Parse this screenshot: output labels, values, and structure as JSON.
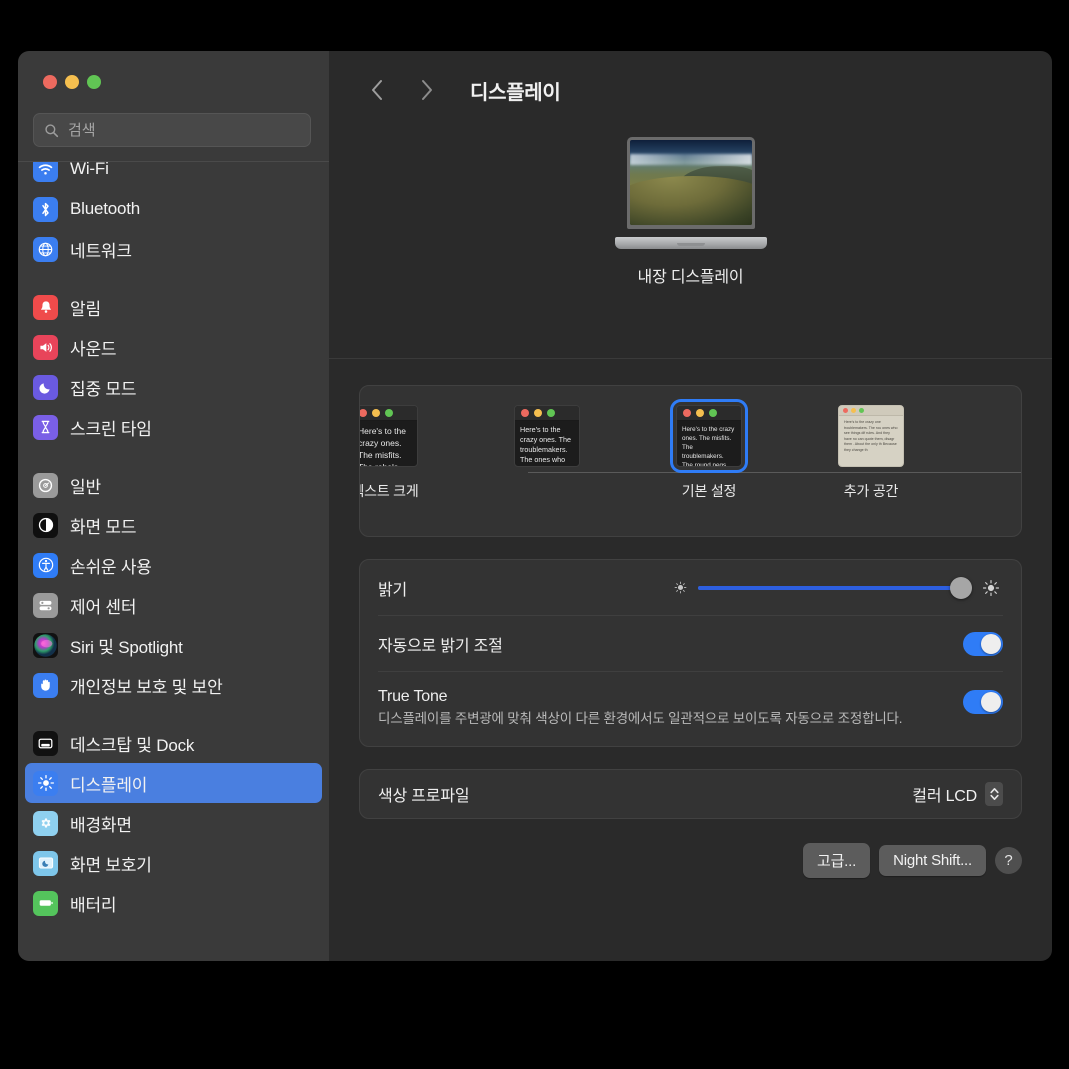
{
  "window": {
    "traffic_lights": [
      {
        "name": "close",
        "color": "#ed6a5f"
      },
      {
        "name": "minimize",
        "color": "#f5bf4f"
      },
      {
        "name": "zoom",
        "color": "#61c554"
      }
    ]
  },
  "search": {
    "placeholder": "검색",
    "value": "",
    "icon": "search-icon"
  },
  "sidebar": {
    "groups": [
      {
        "items": [
          {
            "label": "Wi-Fi",
            "icon": "wifi-icon",
            "selected": false
          },
          {
            "label": "Bluetooth",
            "icon": "bluetooth-icon",
            "selected": false
          },
          {
            "label": "네트워크",
            "icon": "globe-icon",
            "selected": false
          }
        ]
      },
      {
        "items": [
          {
            "label": "알림",
            "icon": "bell-icon",
            "selected": false
          },
          {
            "label": "사운드",
            "icon": "speaker-icon",
            "selected": false
          },
          {
            "label": "집중 모드",
            "icon": "moon-icon",
            "selected": false
          },
          {
            "label": "스크린 타임",
            "icon": "hourglass-icon",
            "selected": false
          }
        ]
      },
      {
        "items": [
          {
            "label": "일반",
            "icon": "gear-icon",
            "selected": false
          },
          {
            "label": "화면 모드",
            "icon": "appearance-icon",
            "selected": false
          },
          {
            "label": "손쉬운 사용",
            "icon": "accessibility-icon",
            "selected": false
          },
          {
            "label": "제어 센터",
            "icon": "control-center-icon",
            "selected": false
          },
          {
            "label": "Siri 및 Spotlight",
            "icon": "siri-icon",
            "selected": false
          },
          {
            "label": "개인정보 보호 및 보안",
            "icon": "hand-privacy-icon",
            "selected": false
          }
        ]
      },
      {
        "items": [
          {
            "label": "데스크탑 및 Dock",
            "icon": "desktop-dock-icon",
            "selected": false
          },
          {
            "label": "디스플레이",
            "icon": "brightness-icon",
            "selected": true
          },
          {
            "label": "배경화면",
            "icon": "wallpaper-icon",
            "selected": false
          },
          {
            "label": "화면 보호기",
            "icon": "screensaver-icon",
            "selected": false
          },
          {
            "label": "배터리",
            "icon": "battery-icon",
            "selected": false
          }
        ]
      }
    ]
  },
  "toolbar": {
    "back_icon": "chevron-left-icon",
    "forward_icon": "chevron-right-icon",
    "title": "디스플레이"
  },
  "hero": {
    "display_name": "내장 디스플레이"
  },
  "scaling": {
    "options": [
      {
        "label": "텍스트 크게",
        "selected": false,
        "preview_text": "Here's to the crazy ones. The misfits. The rebels. The troublemakers.",
        "size_class": "t-large"
      },
      {
        "label": "",
        "selected": false,
        "preview_text": "Here's to the crazy ones. The troublemakers. The ones who see things differently.",
        "size_class": "t-mid"
      },
      {
        "label": "기본 설정",
        "selected": true,
        "preview_text": "Here's to the crazy ones. The misfits. The troublemakers. The round pegs. The ones who see things differently. They're not fond of rules. And they have no respect for the status quo.",
        "size_class": "t-def"
      },
      {
        "label": "추가 공간",
        "selected": false,
        "preview_text": "Here's to the crazy one troublemakers. The rou ones who see things dif rules. And they have no can quote them, disagr them . About the only th Because they change th",
        "size_class": "t-small"
      }
    ]
  },
  "settings": {
    "brightness": {
      "label": "밝기",
      "value_percent": 96,
      "min_icon": "sun-small-icon",
      "max_icon": "sun-large-icon"
    },
    "auto_brightness": {
      "label": "자동으로 밝기 조절",
      "enabled": true
    },
    "true_tone": {
      "label": "True Tone",
      "description": "디스플레이를 주변광에 맞춰 색상이 다른 환경에서도 일관적으로 보이도록 자동으로 조정합니다.",
      "enabled": true
    }
  },
  "color_profile": {
    "label": "색상 프로파일",
    "value": "컬러 LCD",
    "stepper_icon": "chevron-updown-icon"
  },
  "buttons": {
    "advanced": "고급...",
    "night_shift": "Night Shift...",
    "help": "?"
  },
  "colors": {
    "accent_blue": "#2f7cf6",
    "selection_blue": "#4a7fe0",
    "slider_blue": "#2d5fe0",
    "sidebar_bg": "#3a3a3a",
    "main_bg": "#2a2a2a",
    "card_bg": "#333333",
    "desktop_bg": "#000000"
  }
}
